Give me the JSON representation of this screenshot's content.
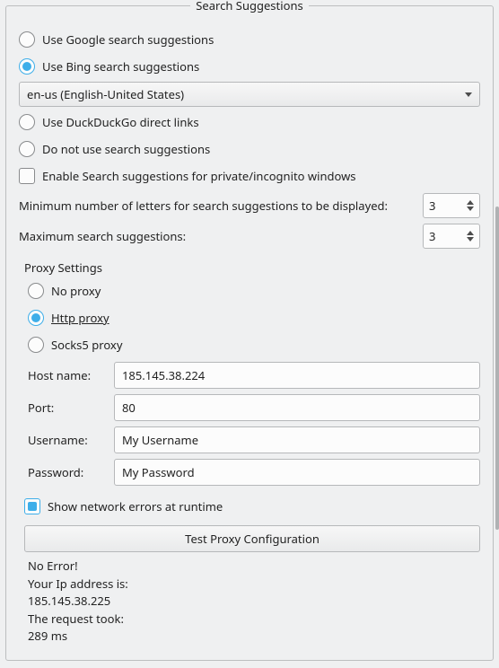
{
  "group_title": "Search Suggestions",
  "search": {
    "google": "Use Google search suggestions",
    "bing": "Use Bing search suggestions",
    "locale_selected": "en-us (English-United States)",
    "ddg": "Use DuckDuckGo direct links",
    "none": "Do not use search suggestions",
    "private": "Enable Search suggestions for private/incognito windows",
    "min_label": "Minimum number of letters for search suggestions to be displayed:",
    "min_value": "3",
    "max_label": "Maximum search suggestions:",
    "max_value": "3"
  },
  "proxy": {
    "heading": "Proxy Settings",
    "no_proxy": "No proxy",
    "http": "Http proxy",
    "socks5": "Socks5 proxy",
    "host_label": "Host name:",
    "host_value": "185.145.38.224",
    "port_label": "Port:",
    "port_value": "80",
    "user_label": "Username:",
    "user_value": "My Username",
    "pass_label": "Password:",
    "pass_value": "My Password",
    "show_errors": "Show network errors at runtime",
    "test_button": "Test Proxy Configuration",
    "result_line1": "No Error!",
    "result_line2": "Your Ip address is:",
    "result_line3": "185.145.38.225",
    "result_line4": "The request took:",
    "result_line5": "289 ms"
  }
}
